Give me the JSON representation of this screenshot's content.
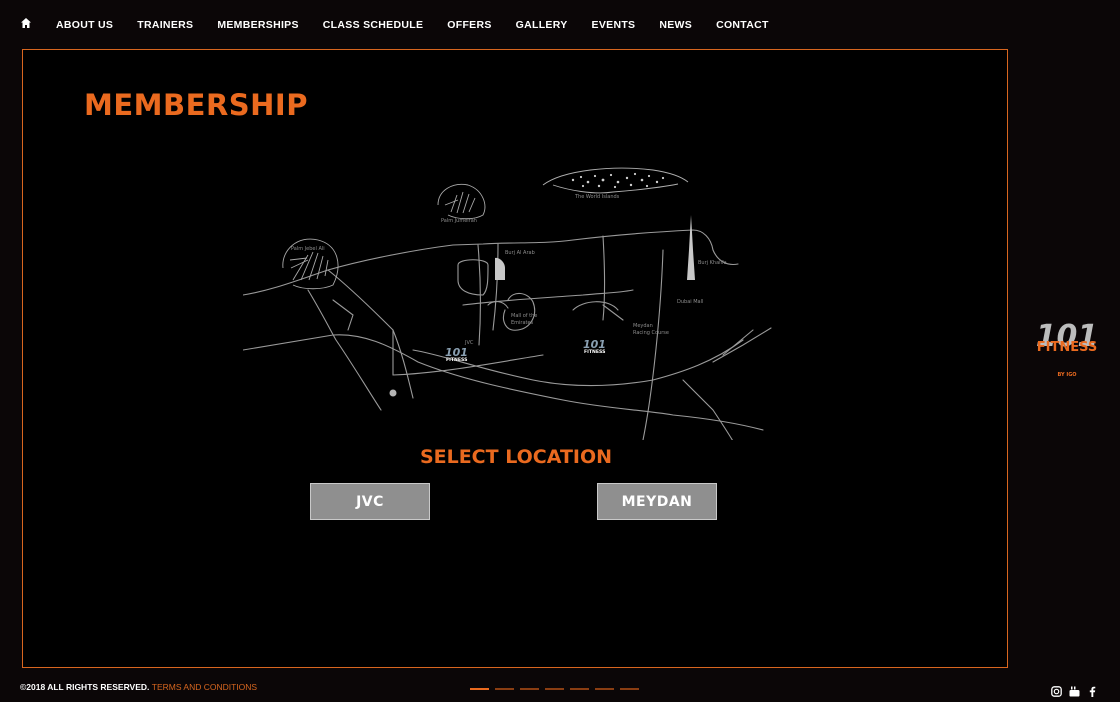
{
  "nav": {
    "items": [
      "ABOUT US",
      "TRAINERS",
      "MEMBERSHIPS",
      "CLASS SCHEDULE",
      "OFFERS",
      "GALLERY",
      "EVENTS",
      "NEWS",
      "CONTACT"
    ]
  },
  "page": {
    "title": "MEMBERSHIP",
    "select_location": "SELECT LOCATION",
    "locations": [
      "JVC",
      "MEYDAN"
    ]
  },
  "map": {
    "labels": {
      "palm_jebel_ali": "Palm Jebel Ali",
      "palm_jumeirah": "Palm Jumeirah",
      "world_islands": "The World Islands",
      "burj_al_arab": "Burj Al Arab",
      "burj_khalifa": "Burj Khalifa",
      "dubai_mall": "Dubai Mall",
      "mall_emirates_1": "Mall of the",
      "mall_emirates_2": "Emirates",
      "jvc": "JVC",
      "meydan_1": "Meydan",
      "meydan_2": "Racing Course"
    },
    "marker_logo_top": "101",
    "marker_logo_text": "FITNESS"
  },
  "brand": {
    "logo_numeral": "101",
    "logo_word": "FITNESS",
    "logo_sub": "BY IGO",
    "accent": "#ea6a1f"
  },
  "footer": {
    "copyright": "©2018 ALL RIGHTS RESERVED.",
    "terms": "TERMS AND CONDITIONS",
    "social_icons": [
      "instagram-icon",
      "youtube-icon",
      "facebook-icon"
    ]
  }
}
